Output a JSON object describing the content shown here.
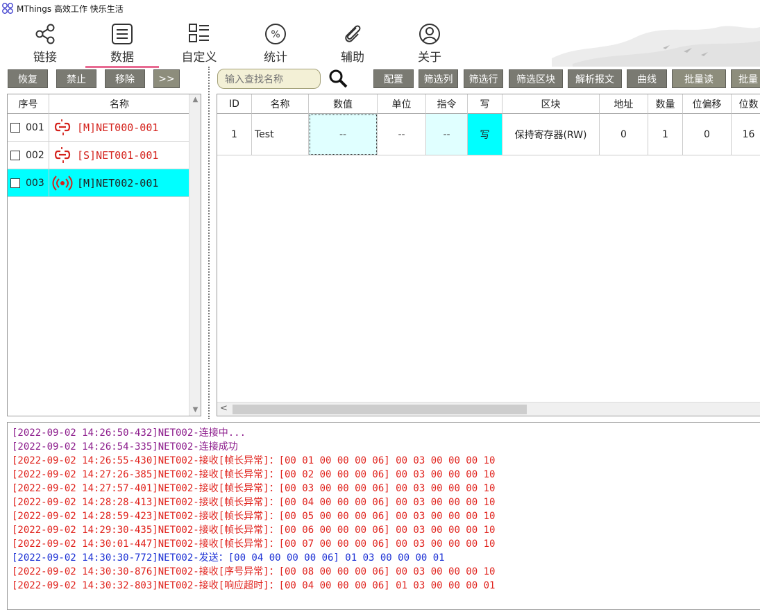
{
  "window": {
    "title": "MThings 高效工作 快乐生活"
  },
  "nav": {
    "items": [
      {
        "label": "链接",
        "icon": "share-icon"
      },
      {
        "label": "数据",
        "icon": "list-icon",
        "active": true
      },
      {
        "label": "自定义",
        "icon": "layout-icon"
      },
      {
        "label": "统计",
        "icon": "percent-icon"
      },
      {
        "label": "辅助",
        "icon": "paperclip-icon"
      },
      {
        "label": "关于",
        "icon": "user-icon"
      }
    ]
  },
  "left_toolbar": {
    "restore": "恢复",
    "disable": "禁止",
    "remove": "移除",
    "expand": ">>"
  },
  "device_list": {
    "headers": {
      "index": "序号",
      "name": "名称"
    },
    "rows": [
      {
        "index": "001",
        "name": "[M]NET000-001",
        "status": "disconnected"
      },
      {
        "index": "002",
        "name": "[S]NET001-001",
        "status": "disconnected"
      },
      {
        "index": "003",
        "name": "[M]NET002-001",
        "status": "connected",
        "selected": true
      }
    ]
  },
  "search": {
    "placeholder": "输入查找名称"
  },
  "right_toolbar": {
    "config": "配置",
    "filter_col": "筛选列",
    "filter_row": "筛选行",
    "filter_block": "筛选区块",
    "parse": "解析报文",
    "curve": "曲线",
    "batch_read": "批量读",
    "batch_write": "批量"
  },
  "data_table": {
    "headers": [
      "ID",
      "名称",
      "数值",
      "单位",
      "指令",
      "写",
      "区块",
      "地址",
      "数量",
      "位偏移",
      "位数"
    ],
    "rows": [
      {
        "id": "1",
        "name": "Test",
        "value": "--",
        "unit": "--",
        "command": "--",
        "write": "写",
        "block": "保持寄存器(RW)",
        "address": "0",
        "count": "1",
        "bit_offset": "0",
        "bits": "16"
      }
    ]
  },
  "colors": {
    "accent": "#e86a92",
    "selected": "#00ffff",
    "log_info": "#8b1a8b",
    "log_error": "#e0221c",
    "log_send": "#1a2fd4"
  },
  "log": [
    {
      "ts": "[2022-09-02 14:26:50-432]",
      "msg": "NET002-连接中...",
      "kind": "info"
    },
    {
      "ts": "[2022-09-02 14:26:54-335]",
      "msg": "NET002-连接成功",
      "kind": "info"
    },
    {
      "ts": "[2022-09-02 14:26:55-430]",
      "msg": "NET002-接收[帧长异常]：[00 01 00 00 00 06] 00 03 00 00 00 10",
      "kind": "error"
    },
    {
      "ts": "[2022-09-02 14:27:26-385]",
      "msg": "NET002-接收[帧长异常]：[00 02 00 00 00 06] 00 03 00 00 00 10",
      "kind": "error"
    },
    {
      "ts": "[2022-09-02 14:27:57-401]",
      "msg": "NET002-接收[帧长异常]：[00 03 00 00 00 06] 00 03 00 00 00 10",
      "kind": "error"
    },
    {
      "ts": "[2022-09-02 14:28:28-413]",
      "msg": "NET002-接收[帧长异常]：[00 04 00 00 00 06] 00 03 00 00 00 10",
      "kind": "error"
    },
    {
      "ts": "[2022-09-02 14:28:59-423]",
      "msg": "NET002-接收[帧长异常]：[00 05 00 00 00 06] 00 03 00 00 00 10",
      "kind": "error"
    },
    {
      "ts": "[2022-09-02 14:29:30-435]",
      "msg": "NET002-接收[帧长异常]：[00 06 00 00 00 06] 00 03 00 00 00 10",
      "kind": "error"
    },
    {
      "ts": "[2022-09-02 14:30:01-447]",
      "msg": "NET002-接收[帧长异常]：[00 07 00 00 00 06] 00 03 00 00 00 10",
      "kind": "error"
    },
    {
      "ts": "[2022-09-02 14:30:30-772]",
      "msg": "NET002-发送：[00 04 00 00 00 06] 01 03 00 00 00 01",
      "kind": "send"
    },
    {
      "ts": "[2022-09-02 14:30:30-876]",
      "msg": "NET002-接收[序号异常]：[00 08 00 00 00 06] 00 03 00 00 00 10",
      "kind": "error"
    },
    {
      "ts": "[2022-09-02 14:30:32-803]",
      "msg": "NET002-接收[响应超时]：[00 04 00 00 00 06] 01 03 00 00 00 01",
      "kind": "error"
    }
  ]
}
